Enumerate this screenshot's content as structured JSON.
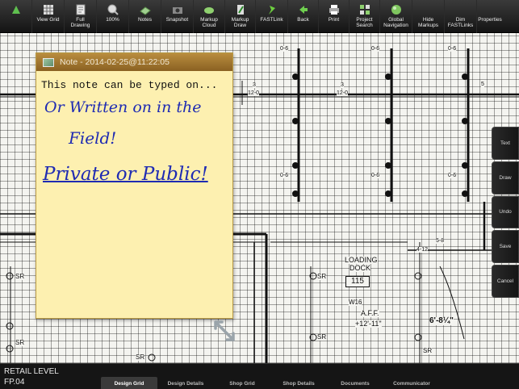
{
  "toolbar": {
    "buttons": [
      {
        "label": "",
        "icon": "home-icon"
      },
      {
        "label": "View Grid",
        "icon": "grid-icon"
      },
      {
        "label": "Full\nDrawing",
        "icon": "full-drawing-icon"
      },
      {
        "label": "100%",
        "icon": "zoom-100-icon"
      },
      {
        "label": "Notes",
        "icon": "notes-icon"
      },
      {
        "label": "Snapshot",
        "icon": "camera-icon"
      },
      {
        "label": "Markup\nCloud",
        "icon": "cloud-icon"
      },
      {
        "label": "Markup\nDraw",
        "icon": "pencil-icon"
      },
      {
        "label": "FASTLink",
        "icon": "pin-icon"
      },
      {
        "label": "Back",
        "icon": "back-arrow-icon"
      },
      {
        "label": "Print",
        "icon": "printer-icon"
      },
      {
        "label": "Project\nSearch",
        "icon": "project-search-icon"
      },
      {
        "label": "Global\nNavigation",
        "icon": "globe-icon"
      },
      {
        "label": "Hide\nMarkups",
        "icon": ""
      },
      {
        "label": "Dim\nFASTLinks",
        "icon": ""
      },
      {
        "label": "Properties",
        "icon": ""
      }
    ]
  },
  "note": {
    "title": "Note - 2014-02-25@11:22:05",
    "typed_text": "This note can be typed on...",
    "handwritten": [
      "Or Written on in the",
      "Field!",
      "Private or Public!"
    ]
  },
  "side_panel": {
    "buttons": [
      "Text",
      "Draw",
      "Undo",
      "Save",
      "Cancel"
    ]
  },
  "blueprint": {
    "labels": [
      "LOADING",
      "DOCK",
      "115",
      "W16",
      "A.F.F.",
      "+12'-11\"",
      "6'-8¼\"",
      "SR",
      "SR",
      "SR",
      "SR",
      "SR",
      "SR",
      "12-0",
      "12-0",
      "0-6",
      "0-6",
      "0-6",
      "0-6",
      "0-6",
      "0-6",
      "5-8",
      "4-12",
      "5",
      "3",
      "3",
      "LOADING DOCK"
    ]
  },
  "footer": {
    "level": "RETAIL LEVEL",
    "sheet": "FP.04",
    "tabs": [
      "Design Grid",
      "Design Details",
      "Shop Grid",
      "Shop Details",
      "Documents",
      "Communicator"
    ],
    "active_tab": "Design Grid"
  },
  "colors": {
    "toolbar": "#1e1e1e",
    "note_background": "#fdf0b0",
    "note_header": "#a47832",
    "handwriting": "#1f2bb3"
  }
}
